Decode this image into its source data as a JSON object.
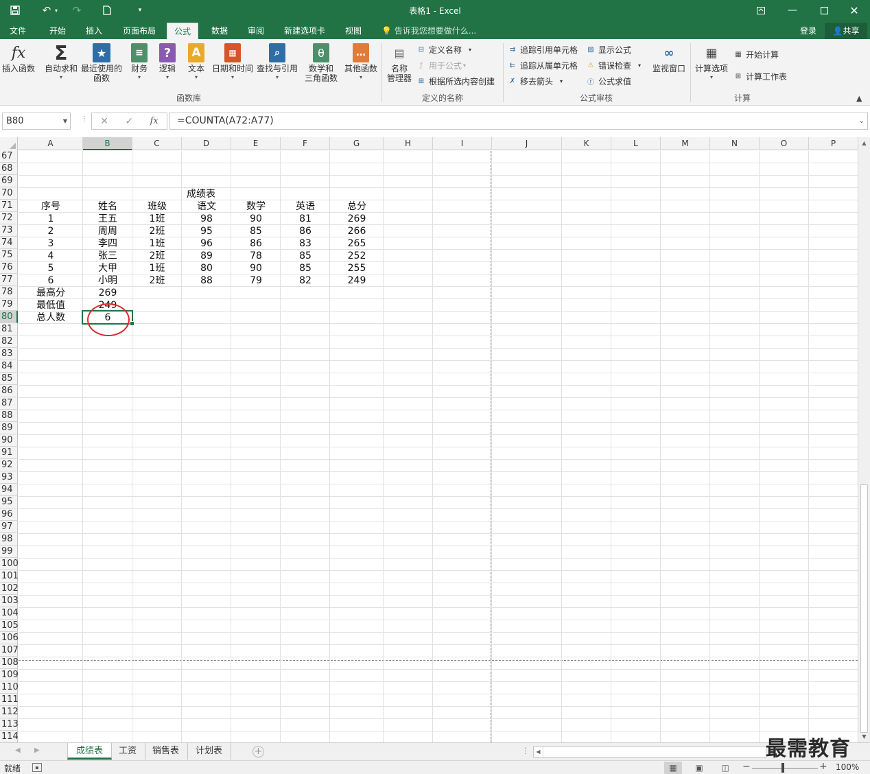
{
  "window": {
    "title": "表格1 - Excel",
    "accent": "#217346"
  },
  "tabs": [
    {
      "label": "文件",
      "active": false
    },
    {
      "label": "开始",
      "active": false
    },
    {
      "label": "插入",
      "active": false
    },
    {
      "label": "页面布局",
      "active": false
    },
    {
      "label": "公式",
      "active": true
    },
    {
      "label": "数据",
      "active": false
    },
    {
      "label": "审阅",
      "active": false
    },
    {
      "label": "新建选项卡",
      "active": false
    },
    {
      "label": "视图",
      "active": false
    }
  ],
  "tell_me": "告诉我您想要做什么...",
  "login": "登录",
  "share": "共享",
  "ribbon": {
    "library": {
      "insert_fn": "插入函数",
      "autosum": "自动求和",
      "recent_1": "最近使用的",
      "recent_2": "函数",
      "finance": "财务",
      "logical": "逻辑",
      "text": "文本",
      "datetime": "日期和时间",
      "lookup": "查找与引用",
      "math_1": "数学和",
      "math_2": "三角函数",
      "other": "其他函数",
      "group": "函数库"
    },
    "names": {
      "manager_1": "名称",
      "manager_2": "管理器",
      "define": "定义名称",
      "use_in": "用于公式",
      "create": "根据所选内容创建",
      "group": "定义的名称"
    },
    "audit": {
      "trace_prec": "追踪引用单元格",
      "trace_dep": "追踪从属单元格",
      "remove_arrows": "移去箭头",
      "show_formulas": "显示公式",
      "error_check": "错误检查",
      "evaluate": "公式求值",
      "watch": "监视窗口",
      "group": "公式审核"
    },
    "calc": {
      "options": "计算选项",
      "calc_now": "开始计算",
      "calc_sheet": "计算工作表",
      "group": "计算"
    }
  },
  "formula_bar": {
    "name_box": "B80",
    "formula": "=COUNTA(A72:A77)"
  },
  "columns": [
    "A",
    "B",
    "C",
    "D",
    "E",
    "F",
    "G",
    "H",
    "I",
    "J",
    "K",
    "L",
    "M",
    "N",
    "O",
    "P"
  ],
  "rows": [
    67,
    68,
    69,
    70,
    71,
    72,
    73,
    74,
    75,
    76,
    77,
    78,
    79,
    80,
    81,
    82,
    83,
    84,
    85,
    86,
    87,
    88,
    89,
    90,
    91,
    92,
    93,
    94,
    95,
    96,
    97,
    98,
    99,
    100,
    101,
    102,
    103,
    104,
    105,
    106,
    107,
    108,
    109,
    110,
    111,
    112,
    113,
    114
  ],
  "selected": {
    "col": "B",
    "row": 80
  },
  "sheet": {
    "title": "成绩表",
    "headers": [
      "序号",
      "姓名",
      "班级",
      "语文",
      "数学",
      "英语",
      "总分"
    ],
    "records": [
      [
        "1",
        "王五",
        "1班",
        "98",
        "90",
        "81",
        "269"
      ],
      [
        "2",
        "周周",
        "2班",
        "95",
        "85",
        "86",
        "266"
      ],
      [
        "3",
        "李四",
        "1班",
        "96",
        "86",
        "83",
        "265"
      ],
      [
        "4",
        "张三",
        "2班",
        "89",
        "78",
        "85",
        "252"
      ],
      [
        "5",
        "大甲",
        "1班",
        "80",
        "90",
        "85",
        "255"
      ],
      [
        "6",
        "小明",
        "2班",
        "88",
        "79",
        "82",
        "249"
      ]
    ],
    "summary": [
      [
        "最高分",
        "269"
      ],
      [
        "最低值",
        "249"
      ],
      [
        "总人数",
        "6"
      ]
    ]
  },
  "sheet_tabs": [
    {
      "label": "成绩表",
      "active": true
    },
    {
      "label": "工资",
      "active": false
    },
    {
      "label": "销售表",
      "active": false
    },
    {
      "label": "计划表",
      "active": false
    }
  ],
  "status": {
    "ready": "就绪",
    "zoom": "100%"
  },
  "watermark": "最需教育"
}
